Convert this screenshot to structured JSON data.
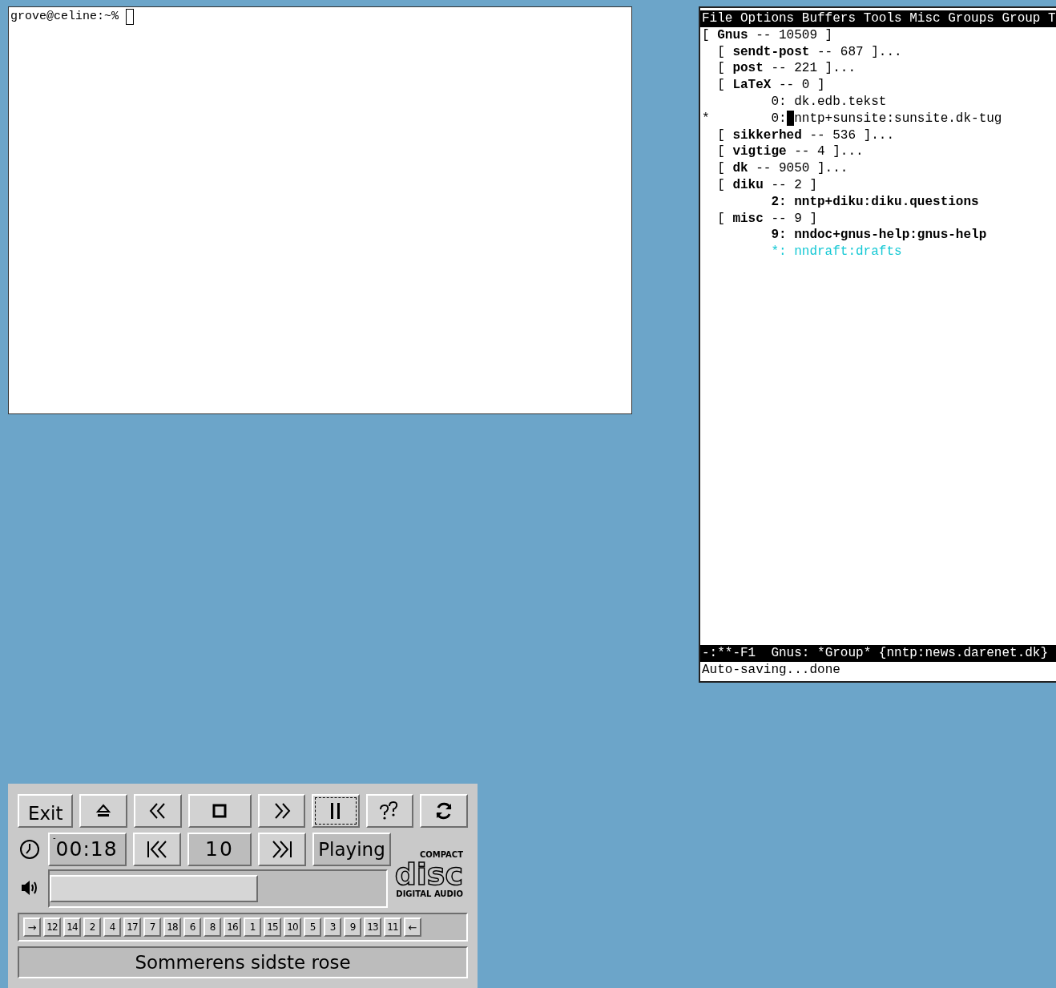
{
  "terminal": {
    "prompt": "grove@celine:~%"
  },
  "emacs": {
    "menu_bar": [
      "File",
      "Options",
      "Buffers",
      "Tools",
      "Misc",
      "Groups",
      "Group",
      "T"
    ],
    "topics": [
      {
        "open": "[",
        "name": "Gnus",
        "rest": "-- 10509 ]",
        "children": [
          {
            "open": "[",
            "name": "sendt-post",
            "rest": "-- 687 ]..."
          },
          {
            "open": "[",
            "name": "post",
            "rest": "-- 221 ]..."
          },
          {
            "open": "[",
            "name": "LaTeX",
            "rest": "-- 0 ]",
            "groups": [
              {
                "count": "0:",
                "name": "dk.edb.tekst",
                "kind": "read",
                "cursor": false
              },
              {
                "mark": "*",
                "count": "0:",
                "name": "nntp+sunsite:sunsite.dk-tug",
                "kind": "read",
                "cursor": true
              }
            ]
          },
          {
            "open": "[",
            "name": "sikkerhed",
            "rest": "-- 536 ]..."
          },
          {
            "open": "[",
            "name": "vigtige",
            "rest": "-- 4 ]..."
          },
          {
            "open": "[",
            "name": "dk",
            "rest": "-- 9050 ]..."
          },
          {
            "open": "[",
            "name": "diku",
            "rest": "-- 2 ]",
            "groups": [
              {
                "count": "2:",
                "name": "nntp+diku:diku.questions",
                "kind": "unread",
                "cursor": false
              }
            ]
          },
          {
            "open": "[",
            "name": "misc",
            "rest": "-- 9 ]",
            "groups": [
              {
                "count": "9:",
                "name": "nndoc+gnus-help:gnus-help",
                "kind": "unread",
                "cursor": false
              },
              {
                "count": "*:",
                "name": "nndraft:drafts",
                "kind": "draft",
                "cursor": false
              }
            ]
          }
        ]
      }
    ],
    "mode_line": "-:**-F1  Gnus: *Group* {nntp:news.darenet.dk}",
    "echo_area": "Auto-saving...done"
  },
  "cd_player": {
    "buttons": [
      {
        "kind": "text",
        "label": "Exit",
        "focused": false
      },
      {
        "kind": "eject",
        "focused": false
      },
      {
        "kind": "rewind",
        "focused": false
      },
      {
        "kind": "stop",
        "focused": false
      },
      {
        "kind": "forward",
        "focused": false
      },
      {
        "kind": "pause",
        "focused": true
      },
      {
        "kind": "help",
        "focused": false
      },
      {
        "kind": "cycle",
        "focused": false
      }
    ],
    "time": {
      "sign": "-",
      "value": "00:18"
    },
    "track": "10",
    "status": "Playing",
    "volume": {
      "level": 0.62
    },
    "logo": {
      "top": "COMPACT",
      "main": "disc",
      "bottom": "DIGITAL AUDIO"
    },
    "playlist": {
      "start": "→",
      "tracks": [
        "12",
        "14",
        "2",
        "4",
        "17",
        "7",
        "18",
        "6",
        "8",
        "16",
        "1",
        "15",
        "10",
        "5",
        "3",
        "9",
        "13",
        "11"
      ],
      "end": "←"
    },
    "title": "Sommerens sidste rose"
  }
}
